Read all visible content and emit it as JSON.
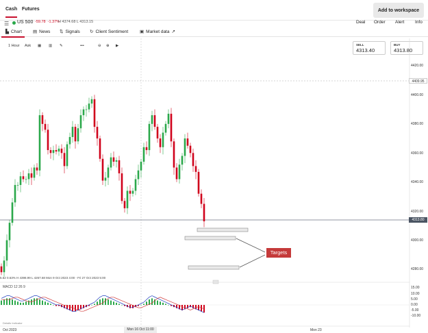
{
  "top_tabs": [
    "Cash",
    "Futures"
  ],
  "workspace_button": "Add to workspace",
  "instrument": {
    "name": "US 500",
    "change": "-59.78",
    "change_pct": "-1.37%",
    "high_low": "H 4374.68  L 4313.15"
  },
  "header_actions": [
    "Deal",
    "Order",
    "Alert",
    "Info"
  ],
  "chart_tabs": [
    "Chart",
    "News",
    "Signals",
    "Client Sentiment",
    "Market data"
  ],
  "toolbar": {
    "interval": "1 Hour",
    "price_type": "Ask"
  },
  "sell": {
    "label": "SELL",
    "value": "4313.40"
  },
  "buy": {
    "label": "BUY",
    "value": "4313.80"
  },
  "y_ticks": [
    "4420.00",
    "4400.00",
    "4380.00",
    "4360.00",
    "4340.00",
    "4320.00",
    "4300.00",
    "4280.00"
  ],
  "price_tags": {
    "level": "4409.95",
    "current": "4313.80"
  },
  "annotation": "Targets",
  "stats_line": "5.62    0.63%    H 4398.99   L 4267.68   Mon 9 Oct 2023 4:00 - Fri 27 Oct 2023 5:00",
  "macd": {
    "label": "MACD  12  26  9",
    "y_ticks": [
      "15.00",
      "10.00",
      "5.00",
      "0.00",
      "-5.00",
      "-10.00"
    ]
  },
  "details_text": "Details Indicator",
  "x_labels": {
    "left": "Oct 2023",
    "crosshair": "Mon 16 Oct 11:00",
    "right": "Mon 23"
  },
  "colors": {
    "up": "#2aa84a",
    "down": "#d0021b",
    "accent": "#c8102e",
    "macd": "#1f3fbf",
    "signal": "#d23c3c"
  },
  "chart_data": {
    "type": "candlestick",
    "ylim": [
      4260,
      4430
    ],
    "closes": [
      4278,
      4286,
      4300,
      4312,
      4326,
      4338,
      4338,
      4344,
      4342,
      4342,
      4346,
      4343,
      4350,
      4348,
      4386,
      4380,
      4376,
      4362,
      4360,
      4362,
      4361,
      4363,
      4360,
      4351,
      4366,
      4371,
      4378,
      4368,
      4377,
      4386,
      4390,
      4390,
      4394,
      4397,
      4378,
      4370,
      4356,
      4341,
      4343,
      4350,
      4357,
      4354,
      4355,
      4346,
      4327,
      4322,
      4334,
      4332,
      4334,
      4342,
      4348,
      4354,
      4364,
      4362,
      4380,
      4386,
      4378,
      4370,
      4364,
      4374,
      4380,
      4387,
      4368,
      4350,
      4342,
      4352,
      4358,
      4370,
      4365,
      4360,
      4351,
      4347,
      4332,
      4325,
      4313
    ],
    "macd_hist": [
      4,
      5,
      6,
      6,
      5,
      4,
      3,
      2,
      2,
      3,
      4,
      5,
      6,
      6,
      5,
      4,
      3,
      2,
      1,
      0,
      -1,
      -1,
      -2,
      -3,
      -4,
      -5,
      -6,
      -6,
      -5,
      -4,
      -3,
      -2,
      -1,
      0,
      1,
      3,
      5,
      6,
      6,
      5,
      4,
      3,
      2,
      1,
      0,
      -1,
      -2,
      -3,
      -3,
      -2,
      -1,
      0,
      1,
      3,
      5,
      6,
      5,
      4,
      3,
      2,
      1,
      0,
      -1,
      -2,
      -3,
      -4,
      -5,
      -4,
      -3,
      -2,
      -3,
      -4,
      -5,
      -6,
      -7
    ]
  }
}
